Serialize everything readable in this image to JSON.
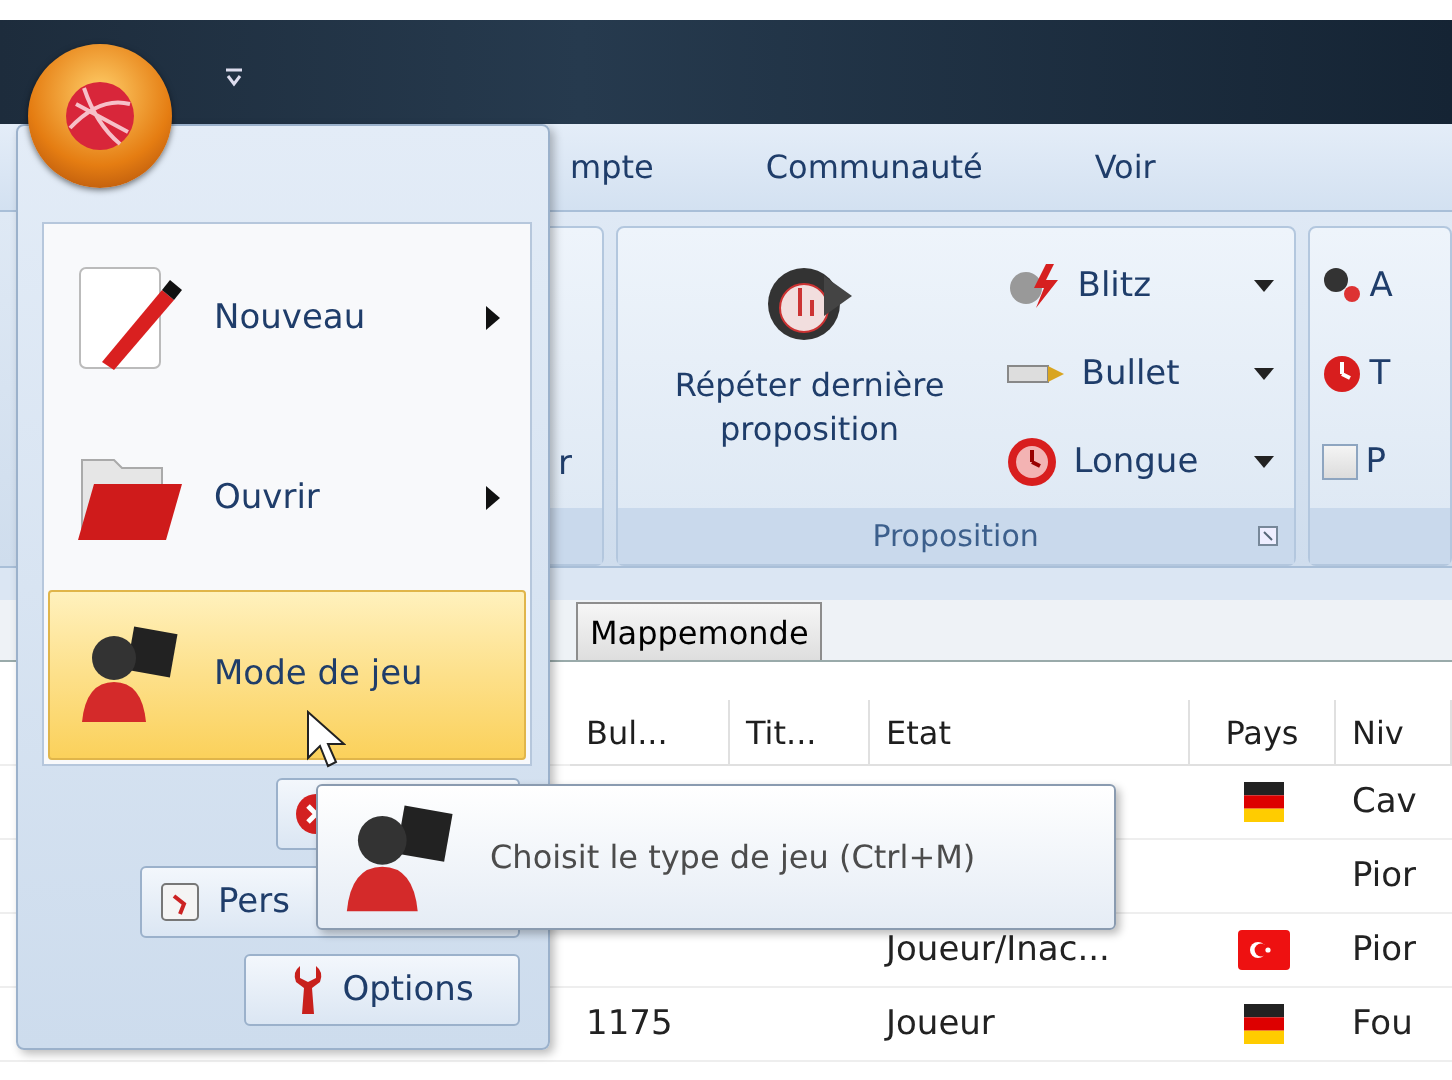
{
  "ribbon_tabs": [
    {
      "label": "mpte"
    },
    {
      "label": "Communauté"
    },
    {
      "label": "Voir"
    }
  ],
  "ribbon": {
    "cut_group_text": "r",
    "proposition": {
      "title": "Proposition",
      "repeat_button": "Répéter dernière proposition",
      "offers": [
        {
          "label": "Blitz"
        },
        {
          "label": "Bullet"
        },
        {
          "label": "Longue"
        }
      ]
    },
    "next_group": [
      {
        "kind": "button",
        "label": "A"
      },
      {
        "kind": "button",
        "label": "T"
      },
      {
        "kind": "checkbox",
        "label": "P",
        "checked": false
      }
    ]
  },
  "doc_tabs": [
    {
      "label": "Mappemonde"
    }
  ],
  "table": {
    "columns": [
      "Bul...",
      "Tit...",
      "Etat",
      "Pays",
      "Niv"
    ],
    "rows": [
      {
        "kind": "german",
        "niv": "Cav"
      },
      {
        "niv": "Pior"
      },
      {
        "etat": "Joueur/Inac...",
        "kind": "turkish",
        "niv": "Pior"
      },
      {
        "bul": "1175",
        "etat": "Joueur",
        "kind": "german",
        "niv": "Fou"
      }
    ]
  },
  "app_menu": {
    "items": [
      {
        "label": "Nouveau",
        "submenu": true,
        "selected": false
      },
      {
        "label": "Ouvrir",
        "submenu": true,
        "selected": false
      },
      {
        "label": "Mode de jeu",
        "submenu": false,
        "selected": true
      }
    ],
    "buttons": [
      {
        "kind": "exit"
      },
      {
        "kind": "personalize",
        "label": "Pers"
      },
      {
        "kind": "options",
        "label": "Options"
      }
    ]
  },
  "tooltip": {
    "text": "Choisit le type de jeu (Ctrl+M)"
  }
}
